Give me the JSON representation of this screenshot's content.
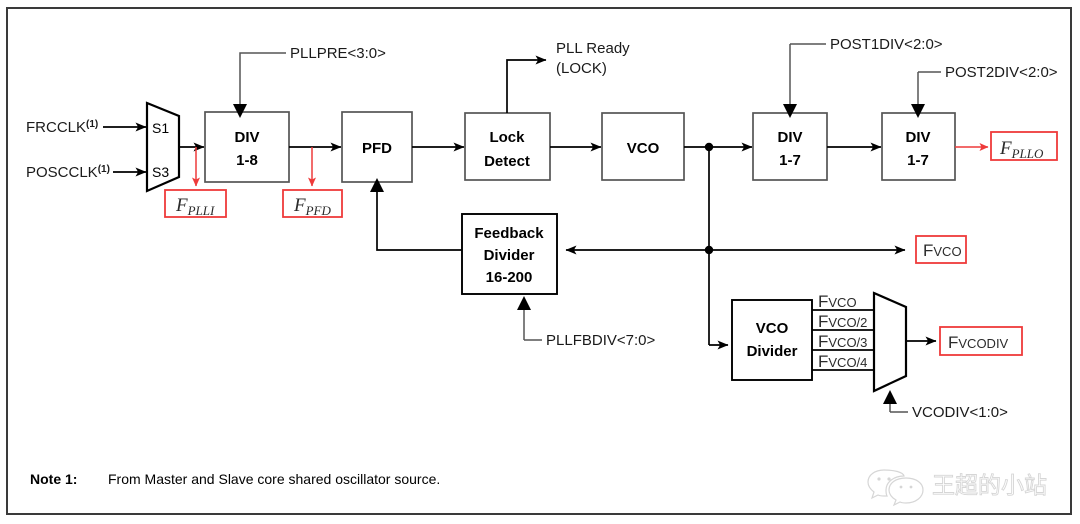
{
  "figure": {
    "frame_color": "#3a3a3a",
    "accent_red": "#ee3a3a",
    "redbox_fill": "#ffffff",
    "line_color": "#000000"
  },
  "inputs": {
    "frcclk": "FRCCLK",
    "frcclk_note": "(1)",
    "poscclk": "POSCCLK",
    "poscclk_note": "(1)"
  },
  "mux_in": {
    "port_top": "S1",
    "port_bottom": "S3"
  },
  "blocks": {
    "div_pre": {
      "line1": "DIV",
      "line2": "1-8"
    },
    "pfd": {
      "line1": "PFD"
    },
    "lock_detect": {
      "line1": "Lock",
      "line2": "Detect"
    },
    "vco": {
      "line1": "VCO"
    },
    "post1": {
      "line1": "DIV",
      "line2": "1-7"
    },
    "post2": {
      "line1": "DIV",
      "line2": "1-7"
    },
    "feedback": {
      "line1": "Feedback",
      "line2": "Divider",
      "line3": "16-200"
    },
    "vco_divider": {
      "line1": "VCO",
      "line2": "Divider"
    }
  },
  "control_signals": {
    "pllpre": "PLLPRE<3:0>",
    "post1div": "POST1DIV<2:0>",
    "post2div": "POST2DIV<2:0>",
    "pllfbdiv": "PLLFBDIV<7:0>",
    "vcodiv": "VCODIV<1:0>"
  },
  "outputs": {
    "pll_ready_line1": "PLL Ready",
    "pll_ready_line2": "(LOCK)"
  },
  "red_labels": {
    "fplli": {
      "main": "F",
      "sub": "PLLI"
    },
    "fpfd": {
      "main": "F",
      "sub": "PFD"
    },
    "fpllo": {
      "main": "F",
      "sub": "PLLO"
    },
    "fvco": {
      "main": "F",
      "sub": "VCO"
    },
    "fvcodiv": {
      "main": "F",
      "sub": "VCODIV"
    }
  },
  "vco_div_taps": [
    {
      "main": "F",
      "sub": "VCO"
    },
    {
      "main": "F",
      "sub": "VCO/2"
    },
    {
      "main": "F",
      "sub": "VCO/3"
    },
    {
      "main": "F",
      "sub": "VCO/4"
    }
  ],
  "note": {
    "label": "Note 1:",
    "text": "From Master and Slave core shared oscillator source."
  },
  "watermark": {
    "text": "王超的小站",
    "icon": "wechat-icon"
  }
}
